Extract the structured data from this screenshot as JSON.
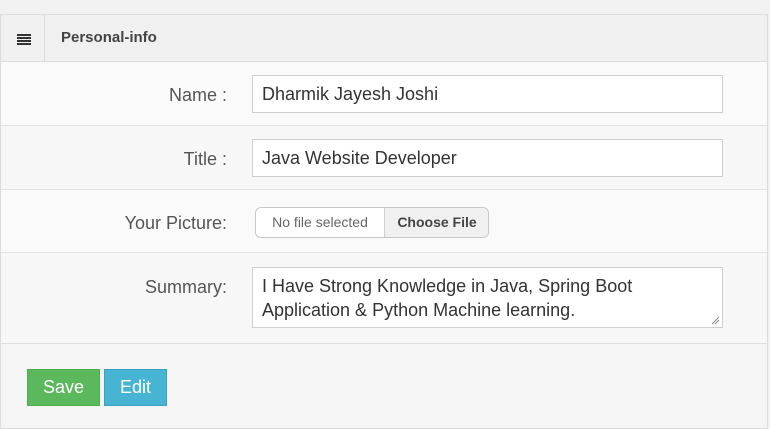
{
  "panel": {
    "title": "Personal-info"
  },
  "form": {
    "name": {
      "label": "Name :",
      "value": "Dharmik Jayesh Joshi"
    },
    "title": {
      "label": "Title :",
      "value": "Java Website Developer"
    },
    "picture": {
      "label": "Your Picture:",
      "file_status": "No file selected",
      "button_label": "Choose File"
    },
    "summary": {
      "label": "Summary:",
      "value": "I Have Strong Knowledge in Java, Spring Boot Application & Python Machine learning."
    }
  },
  "actions": {
    "save_label": "Save",
    "edit_label": "Edit"
  },
  "colors": {
    "save": "#5cb85c",
    "edit": "#46b4d2"
  },
  "icons": {
    "panel_header": "list-icon"
  }
}
